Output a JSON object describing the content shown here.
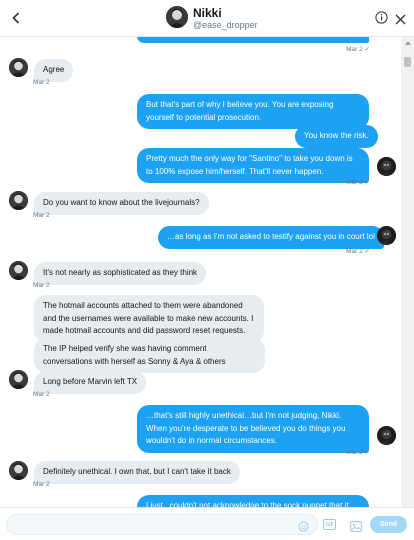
{
  "header": {
    "name": "Nikki",
    "handle": "@ease_dropper"
  },
  "icons": {
    "back": "chevron-left-icon",
    "info": "info-icon",
    "close": "close-icon",
    "emoji": "emoji-icon",
    "gif": "gif-icon",
    "image": "image-icon"
  },
  "colors": {
    "outgoing": "#1da1f2",
    "incoming": "#e6ecf0",
    "send_disabled": "#a5d7f7"
  },
  "messages": [
    {
      "id": "m0",
      "dir": "out",
      "text": "…",
      "partial": true
    },
    {
      "id": "m0ts",
      "text": "Mar 2 ✓"
    },
    {
      "id": "m1",
      "dir": "in",
      "text": "Agree"
    },
    {
      "id": "m1ts",
      "text": "Mar 2"
    },
    {
      "id": "m2",
      "dir": "out",
      "text": "But that's part of why I believe you. You are exposing yourself to potential prosecution."
    },
    {
      "id": "m3",
      "dir": "out",
      "text": "You know the risk."
    },
    {
      "id": "m4",
      "dir": "out",
      "text": "Pretty much the only way for \"Santino\" to take you down is to 100% expose him/herself. That'll never happen."
    },
    {
      "id": "m4ts",
      "text": "Mar 2 ✓"
    },
    {
      "id": "m5",
      "dir": "in",
      "text": "Do you want to know about the livejournals?"
    },
    {
      "id": "m5ts",
      "text": "Mar 2"
    },
    {
      "id": "m6",
      "dir": "out",
      "text": "…as long as I'm not asked to testify against you in court lol"
    },
    {
      "id": "m6ts",
      "text": "Mar 2 ✓"
    },
    {
      "id": "m7",
      "dir": "in",
      "text": "It's not nearly as sophisticated as they think"
    },
    {
      "id": "m7ts",
      "text": "Mar 2"
    },
    {
      "id": "m8",
      "dir": "in",
      "text": "The hotmail accounts attached to them were abandoned and the usernames were available to make new accounts. I made hotmail accounts and did password reset requests."
    },
    {
      "id": "m9",
      "dir": "in",
      "text": "The IP helped verify she was having comment conversations with herself as Sonny & Aya & others"
    },
    {
      "id": "m10",
      "dir": "in",
      "text": "Long before Marvin left TX"
    },
    {
      "id": "m10ts",
      "text": "Mar 2"
    },
    {
      "id": "m11",
      "dir": "out",
      "text": "…that's still highly unethical…but I'm not judging, Nikki. When you're desperate to be believed you do things you wouldn't do in normal circumstances."
    },
    {
      "id": "m11ts",
      "text": "Mar 2 ✓"
    },
    {
      "id": "m12",
      "dir": "in",
      "text": "Definitely unethical.  I own that, but I can't take it back"
    },
    {
      "id": "m12ts",
      "text": "Mar 2"
    },
    {
      "id": "m13",
      "dir": "out",
      "text": "I just...couldn't not acknowledge to the sock puppet that it was",
      "partial": true
    }
  ],
  "composer": {
    "placeholder": "",
    "send_label": "Send",
    "gif_label": "GIF"
  }
}
